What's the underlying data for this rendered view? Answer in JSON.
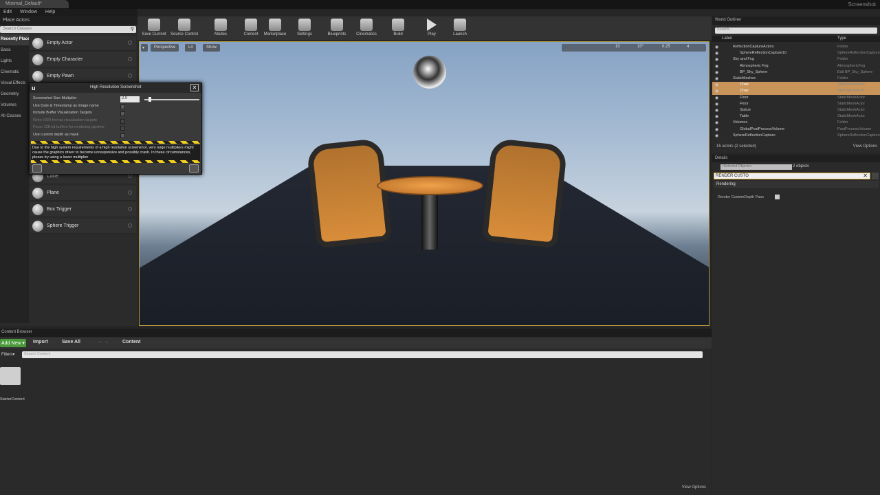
{
  "window": {
    "tab_title": "Minimal_Default*",
    "right_title": "Screenshot"
  },
  "menu": [
    "Edit",
    "Window",
    "Help"
  ],
  "place_actors": {
    "title": "Place Actors",
    "search_placeholder": "Search Classes",
    "categories": [
      "Recently Placed",
      "Basic",
      "Lights",
      "Cinematic",
      "Visual Effects",
      "Geometry",
      "Volumes",
      "All Classes"
    ],
    "items": [
      "Empty Actor",
      "Empty Character",
      "Empty Pawn",
      "Cone",
      "Plane",
      "Box Trigger",
      "Sphere Trigger"
    ]
  },
  "toolbar": {
    "buttons": [
      "Save Current",
      "Source Control",
      "Modes",
      "Content",
      "Marketplace",
      "Settings",
      "Blueprints",
      "Cinematics",
      "Build",
      "Play",
      "Launch"
    ]
  },
  "viewport": {
    "perspective": "Perspective",
    "lit": "Lit",
    "show": "Show",
    "grid_value": "10",
    "angle_value": "10°",
    "scale_value": "0.25",
    "camera_speed": "4"
  },
  "screenshot_dialog": {
    "title": "High Resolution Screenshot",
    "rows": [
      {
        "label": "Screenshot Size Multiplier",
        "value": "2.0"
      },
      {
        "label": "Use Date & Timestamp as image name"
      },
      {
        "label": "Include Buffer Visualization Targets"
      },
      {
        "label": "Write HDR format visualization targets"
      },
      {
        "label": "Force 128-bit buffers for rendering pipeline"
      },
      {
        "label": "Use custom depth as mask"
      }
    ],
    "warning": "Due to the high system requirements of a high resolution screenshot, very large multipliers might cause the graphics driver to become unresponsive and possibly crash. In these circumstances, please try using a lower multiplier"
  },
  "outliner": {
    "title": "World Outliner",
    "search_placeholder": "Search...",
    "col_label": "Label",
    "col_type": "Type",
    "rows": [
      {
        "label": "ReflectionCaptureActors",
        "type": "Folder",
        "indent": 1,
        "sel": false
      },
      {
        "label": "SphereReflectionCapture10",
        "type": "SphereReflectionCapture",
        "indent": 2,
        "sel": false
      },
      {
        "label": "Sky and Fog",
        "type": "Folder",
        "indent": 1,
        "sel": false
      },
      {
        "label": "Atmospheric Fog",
        "type": "AtmosphericFog",
        "indent": 2,
        "sel": false
      },
      {
        "label": "BP_Sky_Sphere",
        "type": "Edit BP_Sky_Sphere",
        "indent": 2,
        "sel": false
      },
      {
        "label": "StaticMeshes",
        "type": "Folder",
        "indent": 1,
        "sel": false
      },
      {
        "label": "Chair",
        "type": "StaticMeshActor",
        "indent": 2,
        "sel": true
      },
      {
        "label": "Chair",
        "type": "StaticMeshActor",
        "indent": 2,
        "sel": true
      },
      {
        "label": "Floor",
        "type": "StaticMeshActor",
        "indent": 2,
        "sel": false
      },
      {
        "label": "Floor",
        "type": "StaticMeshActor",
        "indent": 2,
        "sel": false
      },
      {
        "label": "Statue",
        "type": "StaticMeshActor",
        "indent": 2,
        "sel": false
      },
      {
        "label": "Table",
        "type": "StaticMeshActor",
        "indent": 2,
        "sel": false
      },
      {
        "label": "Volumes",
        "type": "Folder",
        "indent": 1,
        "sel": false
      },
      {
        "label": "GlobalPostProcessVolume",
        "type": "PostProcessVolume",
        "indent": 2,
        "sel": false
      },
      {
        "label": "SphereReflectionCapture",
        "type": "SphereReflectionCapture",
        "indent": 1,
        "sel": false
      }
    ],
    "status": "15 actors (2 selected)",
    "view_options": "View Options"
  },
  "details": {
    "title": "Details",
    "selected_label": "<Selected Objects>",
    "object_count": "2 objects",
    "search_value": "RENDER CUSTO",
    "category": "Rendering",
    "property": "Render CustomDepth Pass"
  },
  "content_browser": {
    "title": "Content Browser",
    "add_new": "Add New",
    "import": "Import",
    "save_all": "Save All",
    "path": "Content",
    "filters": "Filters",
    "search_placeholder": "Search Content",
    "folder": "StarterContent",
    "view_options": "View Options"
  }
}
